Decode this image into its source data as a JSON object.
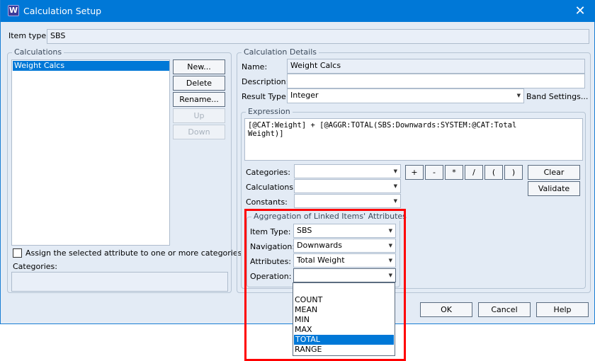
{
  "window": {
    "title": "Calculation Setup",
    "app_icon_letter": "W",
    "close_glyph": "✕"
  },
  "item_type": {
    "label": "Item type:",
    "value": "SBS"
  },
  "calculations": {
    "group_title": "Calculations",
    "items": [
      {
        "label": "Weight Calcs",
        "selected": true
      }
    ],
    "buttons": {
      "new": "New...",
      "delete": "Delete",
      "rename": "Rename...",
      "up": "Up",
      "down": "Down"
    },
    "assign_checkbox": {
      "label": "Assign the selected attribute to one or more categories",
      "checked": false
    },
    "categories_label": "Categories:",
    "categories_value": ""
  },
  "details": {
    "group_title": "Calculation Details",
    "name_label": "Name:",
    "name_value": "Weight Calcs",
    "description_label": "Description:",
    "description_value": "",
    "result_type_label": "Result Type:",
    "result_type_value": "Integer",
    "band_settings": "Band Settings..."
  },
  "expression": {
    "group_title": "Expression",
    "line1": "[@CAT:Weight] + [@AGGR:TOTAL(SBS:Downwards:SYSTEM:@CAT:Total",
    "line2": "Weight)]",
    "categories_label": "Categories:",
    "categories_value": "",
    "calculations_label": "Calculations:",
    "calculations_value": "",
    "constants_label": "Constants:",
    "constants_value": "",
    "operators": [
      "+",
      "-",
      "*",
      "/",
      "(",
      ")"
    ],
    "clear": "Clear",
    "validate": "Validate"
  },
  "aggregation": {
    "group_title": "Aggregation of Linked Items' Attributes",
    "item_type_label": "Item Type:",
    "item_type_value": "SBS",
    "navigation_label": "Navigation:",
    "navigation_value": "Downwards",
    "attributes_label": "Attributes:",
    "attributes_value": "Total Weight",
    "operation_label": "Operation:",
    "operation_value": "",
    "operation_options": [
      "",
      "COUNT",
      "MEAN",
      "MIN",
      "MAX",
      "TOTAL",
      "RANGE"
    ],
    "operation_highlighted": "TOTAL"
  },
  "footer": {
    "ok": "OK",
    "cancel": "Cancel",
    "help": "Help"
  },
  "colors": {
    "accent": "#0078d7",
    "highlight_box": "#ff0000",
    "dialog_bg": "#e3ebf5"
  }
}
